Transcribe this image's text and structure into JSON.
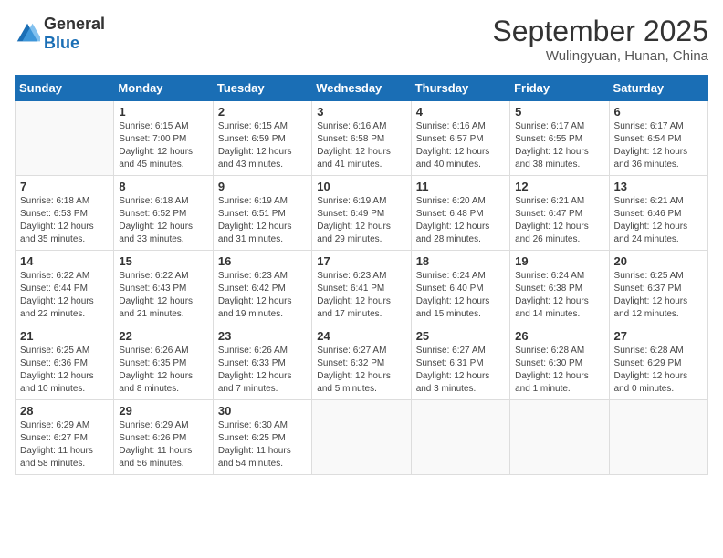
{
  "header": {
    "logo_general": "General",
    "logo_blue": "Blue",
    "month": "September 2025",
    "location": "Wulingyuan, Hunan, China"
  },
  "days_of_week": [
    "Sunday",
    "Monday",
    "Tuesday",
    "Wednesday",
    "Thursday",
    "Friday",
    "Saturday"
  ],
  "weeks": [
    [
      {
        "day": "",
        "info": ""
      },
      {
        "day": "1",
        "info": "Sunrise: 6:15 AM\nSunset: 7:00 PM\nDaylight: 12 hours\nand 45 minutes."
      },
      {
        "day": "2",
        "info": "Sunrise: 6:15 AM\nSunset: 6:59 PM\nDaylight: 12 hours\nand 43 minutes."
      },
      {
        "day": "3",
        "info": "Sunrise: 6:16 AM\nSunset: 6:58 PM\nDaylight: 12 hours\nand 41 minutes."
      },
      {
        "day": "4",
        "info": "Sunrise: 6:16 AM\nSunset: 6:57 PM\nDaylight: 12 hours\nand 40 minutes."
      },
      {
        "day": "5",
        "info": "Sunrise: 6:17 AM\nSunset: 6:55 PM\nDaylight: 12 hours\nand 38 minutes."
      },
      {
        "day": "6",
        "info": "Sunrise: 6:17 AM\nSunset: 6:54 PM\nDaylight: 12 hours\nand 36 minutes."
      }
    ],
    [
      {
        "day": "7",
        "info": "Sunrise: 6:18 AM\nSunset: 6:53 PM\nDaylight: 12 hours\nand 35 minutes."
      },
      {
        "day": "8",
        "info": "Sunrise: 6:18 AM\nSunset: 6:52 PM\nDaylight: 12 hours\nand 33 minutes."
      },
      {
        "day": "9",
        "info": "Sunrise: 6:19 AM\nSunset: 6:51 PM\nDaylight: 12 hours\nand 31 minutes."
      },
      {
        "day": "10",
        "info": "Sunrise: 6:19 AM\nSunset: 6:49 PM\nDaylight: 12 hours\nand 29 minutes."
      },
      {
        "day": "11",
        "info": "Sunrise: 6:20 AM\nSunset: 6:48 PM\nDaylight: 12 hours\nand 28 minutes."
      },
      {
        "day": "12",
        "info": "Sunrise: 6:21 AM\nSunset: 6:47 PM\nDaylight: 12 hours\nand 26 minutes."
      },
      {
        "day": "13",
        "info": "Sunrise: 6:21 AM\nSunset: 6:46 PM\nDaylight: 12 hours\nand 24 minutes."
      }
    ],
    [
      {
        "day": "14",
        "info": "Sunrise: 6:22 AM\nSunset: 6:44 PM\nDaylight: 12 hours\nand 22 minutes."
      },
      {
        "day": "15",
        "info": "Sunrise: 6:22 AM\nSunset: 6:43 PM\nDaylight: 12 hours\nand 21 minutes."
      },
      {
        "day": "16",
        "info": "Sunrise: 6:23 AM\nSunset: 6:42 PM\nDaylight: 12 hours\nand 19 minutes."
      },
      {
        "day": "17",
        "info": "Sunrise: 6:23 AM\nSunset: 6:41 PM\nDaylight: 12 hours\nand 17 minutes."
      },
      {
        "day": "18",
        "info": "Sunrise: 6:24 AM\nSunset: 6:40 PM\nDaylight: 12 hours\nand 15 minutes."
      },
      {
        "day": "19",
        "info": "Sunrise: 6:24 AM\nSunset: 6:38 PM\nDaylight: 12 hours\nand 14 minutes."
      },
      {
        "day": "20",
        "info": "Sunrise: 6:25 AM\nSunset: 6:37 PM\nDaylight: 12 hours\nand 12 minutes."
      }
    ],
    [
      {
        "day": "21",
        "info": "Sunrise: 6:25 AM\nSunset: 6:36 PM\nDaylight: 12 hours\nand 10 minutes."
      },
      {
        "day": "22",
        "info": "Sunrise: 6:26 AM\nSunset: 6:35 PM\nDaylight: 12 hours\nand 8 minutes."
      },
      {
        "day": "23",
        "info": "Sunrise: 6:26 AM\nSunset: 6:33 PM\nDaylight: 12 hours\nand 7 minutes."
      },
      {
        "day": "24",
        "info": "Sunrise: 6:27 AM\nSunset: 6:32 PM\nDaylight: 12 hours\nand 5 minutes."
      },
      {
        "day": "25",
        "info": "Sunrise: 6:27 AM\nSunset: 6:31 PM\nDaylight: 12 hours\nand 3 minutes."
      },
      {
        "day": "26",
        "info": "Sunrise: 6:28 AM\nSunset: 6:30 PM\nDaylight: 12 hours\nand 1 minute."
      },
      {
        "day": "27",
        "info": "Sunrise: 6:28 AM\nSunset: 6:29 PM\nDaylight: 12 hours\nand 0 minutes."
      }
    ],
    [
      {
        "day": "28",
        "info": "Sunrise: 6:29 AM\nSunset: 6:27 PM\nDaylight: 11 hours\nand 58 minutes."
      },
      {
        "day": "29",
        "info": "Sunrise: 6:29 AM\nSunset: 6:26 PM\nDaylight: 11 hours\nand 56 minutes."
      },
      {
        "day": "30",
        "info": "Sunrise: 6:30 AM\nSunset: 6:25 PM\nDaylight: 11 hours\nand 54 minutes."
      },
      {
        "day": "",
        "info": ""
      },
      {
        "day": "",
        "info": ""
      },
      {
        "day": "",
        "info": ""
      },
      {
        "day": "",
        "info": ""
      }
    ]
  ]
}
